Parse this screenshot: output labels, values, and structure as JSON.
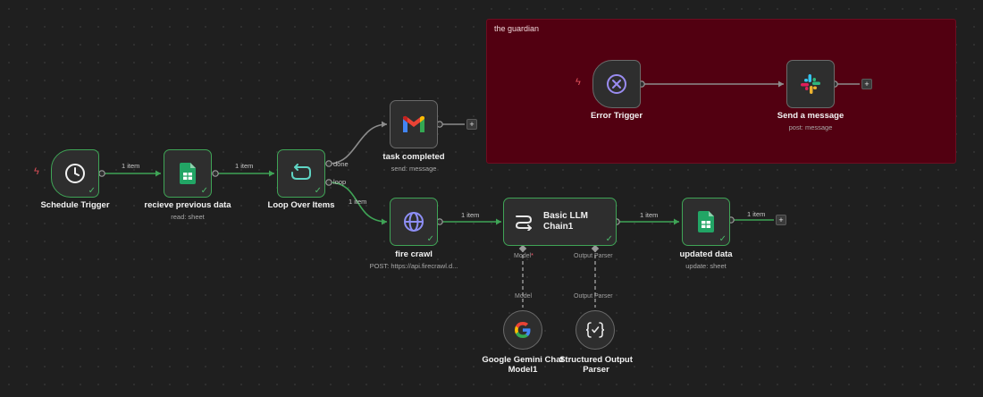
{
  "sticky": {
    "title": "the guardian"
  },
  "edge_labels": {
    "schedule_to_recieve": "1 item",
    "recieve_to_loop": "1 item",
    "loop_to_firecrawl": "1 item",
    "firecrawl_to_chain": "1 item",
    "chain_to_updated": "1 item",
    "updated_out": "1 item"
  },
  "loop_ports": {
    "done": "done",
    "loop": "loop"
  },
  "chain_ports": {
    "model": "Model",
    "parser": "Output Parser"
  },
  "nodes": {
    "schedule_trigger": {
      "label": "Schedule Trigger",
      "icon": "clock-icon"
    },
    "recieve_data": {
      "label": "recieve previous data",
      "subtitle": "read: sheet",
      "icon": "google-sheets-icon"
    },
    "loop_over_items": {
      "label": "Loop Over Items",
      "icon": "loop-icon"
    },
    "task_completed": {
      "label": "task completed",
      "subtitle": "send: message",
      "icon": "gmail-icon"
    },
    "fire_crawl": {
      "label": "fire crawl",
      "subtitle": "POST: https://api.firecrawl.d...",
      "icon": "globe-icon"
    },
    "basic_llm_chain": {
      "label": "Basic LLM Chain1",
      "icon": "chain-icon"
    },
    "updated_data": {
      "label": "updated data",
      "subtitle": "update: sheet",
      "icon": "google-sheets-icon"
    },
    "gemini_model": {
      "label_line1": "Google Gemini Chat",
      "label_line2": "Model1",
      "icon": "google-icon"
    },
    "output_parser": {
      "label_line1": "Structured Output",
      "label_line2": "Parser",
      "icon": "braces-icon"
    },
    "error_trigger": {
      "label": "Error Trigger",
      "icon": "x-circle-icon"
    },
    "send_message": {
      "label": "Send a message",
      "subtitle": "post: message",
      "icon": "slack-icon"
    }
  },
  "colors": {
    "success": "#3fa456",
    "sticky_bg": "#520011",
    "canvas": "#1f1f1f"
  }
}
